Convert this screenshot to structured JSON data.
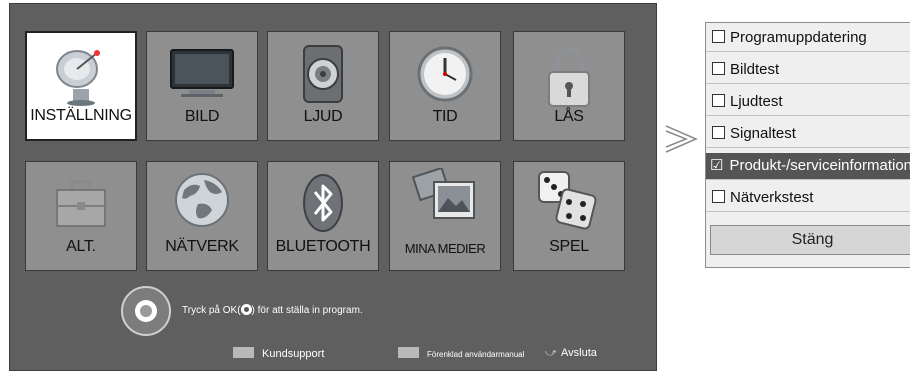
{
  "menu": {
    "tiles": [
      {
        "label": "INSTÄLLNING",
        "icon": "satellite-dish-icon",
        "selected": true
      },
      {
        "label": "BILD",
        "icon": "tv-monitor-icon"
      },
      {
        "label": "LJUD",
        "icon": "speaker-icon"
      },
      {
        "label": "TID",
        "icon": "clock-icon"
      },
      {
        "label": "LÅS",
        "icon": "padlock-icon"
      },
      {
        "label": "ALT.",
        "icon": "toolbox-icon"
      },
      {
        "label": "NÄTVERK",
        "icon": "globe-icon"
      },
      {
        "label": "BLUETOOTH",
        "icon": "bluetooth-icon"
      },
      {
        "label": "MINA MEDIER",
        "icon": "media-photos-icon"
      },
      {
        "label": "SPEL",
        "icon": "dice-icon"
      }
    ],
    "hint_before": "Tryck på OK(",
    "hint_after": ") för att ställa in program.",
    "footer": {
      "support": "Kundsupport",
      "manual": "Förenklad användarmanual",
      "exit": "Avsluta"
    }
  },
  "panel": {
    "items": [
      {
        "label": "Programuppdatering",
        "checked": false
      },
      {
        "label": "Bildtest",
        "checked": false
      },
      {
        "label": "Ljudtest",
        "checked": false
      },
      {
        "label": "Signaltest",
        "checked": false
      },
      {
        "label": "Produkt-/serviceinformation",
        "checked": true
      },
      {
        "label": "Nätverkstest",
        "checked": false
      }
    ],
    "close": "Stäng"
  },
  "colors": {
    "background": "#5f5f5f",
    "tile": "#8f8f8f",
    "selected_row": "#555555"
  }
}
